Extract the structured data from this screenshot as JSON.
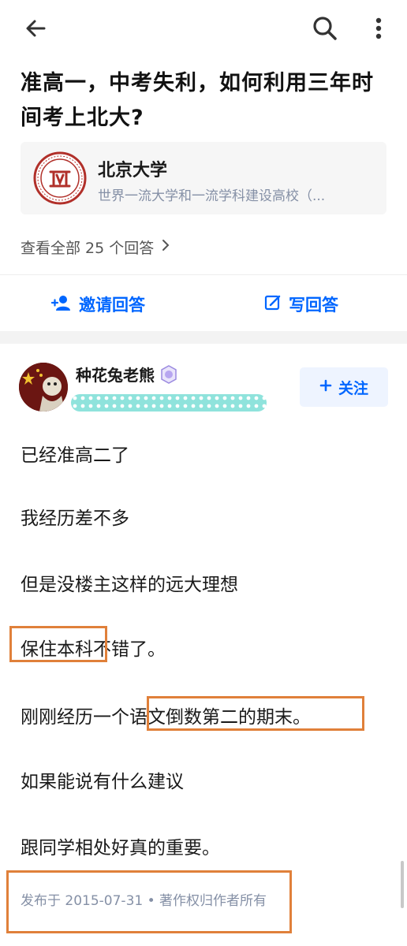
{
  "topbar": {
    "back_icon": "arrow-left-icon",
    "search_icon": "search-icon",
    "more_icon": "more-vertical-icon"
  },
  "question": {
    "title_line1": "准高一，中考失利，如何利用三年时",
    "title_line2": "间考上北大?"
  },
  "university": {
    "name": "北京大学",
    "description": "世界一流大学和一流学科建设高校（..."
  },
  "answers": {
    "view_all_label": "查看全部 25 个回答"
  },
  "actions": {
    "invite_label": "邀请回答",
    "write_label": "写回答"
  },
  "author": {
    "name": "种花兔老熊",
    "follow_label": "关注"
  },
  "content": {
    "p1": "已经准高二了",
    "p2": "我经历差不多",
    "p3": "但是没楼主这样的远大理想",
    "p4_highlight": "保住本科",
    "p4_rest": "不错了。",
    "p5_prefix": "刚刚经历一个",
    "p5_highlight": "语文倒数第二的期末。",
    "p6": "如果能说有什么建议",
    "p7": "跟同学相处好真的重要。"
  },
  "meta": {
    "published": "发布于 2015-07-31 • 著作权归作者所有"
  },
  "colors": {
    "accent": "#0066ff",
    "highlight_box": "#e0803a",
    "muted": "#8590a6"
  }
}
